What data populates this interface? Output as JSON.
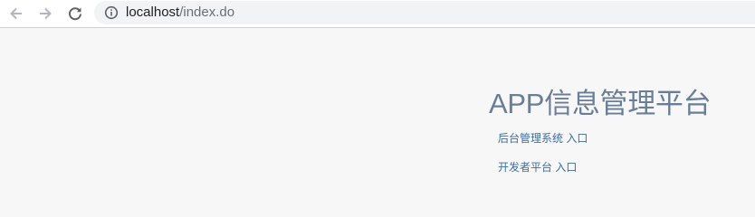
{
  "browser": {
    "url_host": "localhost",
    "url_path": "/index.do",
    "icons": {
      "back": "arrow-left-icon",
      "forward": "arrow-right-icon",
      "reload": "reload-icon",
      "site_info": "info-icon"
    }
  },
  "page": {
    "title": "APP信息管理平台",
    "links": {
      "backend": "后台管理系统 入口",
      "developer": "开发者平台 入口"
    },
    "colors": {
      "title": "#6a7e98",
      "link": "#3c6ea3",
      "background": "#f7f7f7"
    }
  }
}
